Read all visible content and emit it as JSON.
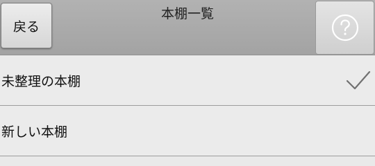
{
  "nav": {
    "title": "本棚一覧",
    "back_label": "戻る",
    "help_icon": "question-circle-icon"
  },
  "shelves": [
    {
      "label": "未整理の本棚",
      "selected": true
    },
    {
      "label": "新しい本棚",
      "selected": false
    }
  ],
  "colors": {
    "nav_bg": "#a8a8a8",
    "list_bg": "#ebebeb",
    "divider": "#9c9c9c",
    "check": "#707070"
  }
}
